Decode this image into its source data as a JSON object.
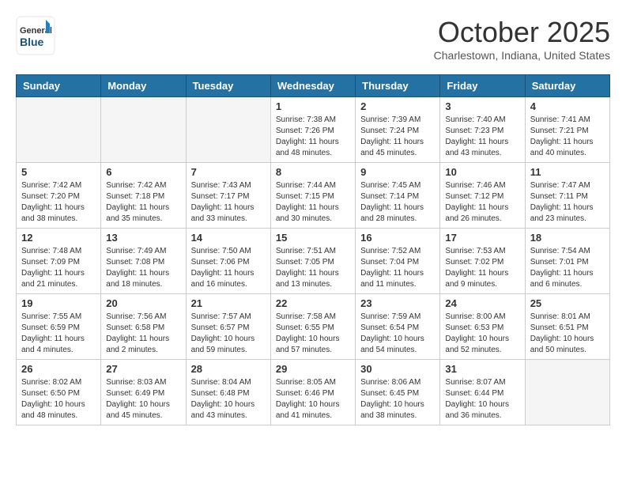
{
  "header": {
    "logo": {
      "general": "General",
      "blue": "Blue"
    },
    "title": "October 2025",
    "location": "Charlestown, Indiana, United States"
  },
  "calendar": {
    "days_of_week": [
      "Sunday",
      "Monday",
      "Tuesday",
      "Wednesday",
      "Thursday",
      "Friday",
      "Saturday"
    ],
    "weeks": [
      {
        "days": [
          {
            "number": "",
            "info": ""
          },
          {
            "number": "",
            "info": ""
          },
          {
            "number": "",
            "info": ""
          },
          {
            "number": "1",
            "info": "Sunrise: 7:38 AM\nSunset: 7:26 PM\nDaylight: 11 hours\nand 48 minutes."
          },
          {
            "number": "2",
            "info": "Sunrise: 7:39 AM\nSunset: 7:24 PM\nDaylight: 11 hours\nand 45 minutes."
          },
          {
            "number": "3",
            "info": "Sunrise: 7:40 AM\nSunset: 7:23 PM\nDaylight: 11 hours\nand 43 minutes."
          },
          {
            "number": "4",
            "info": "Sunrise: 7:41 AM\nSunset: 7:21 PM\nDaylight: 11 hours\nand 40 minutes."
          }
        ]
      },
      {
        "days": [
          {
            "number": "5",
            "info": "Sunrise: 7:42 AM\nSunset: 7:20 PM\nDaylight: 11 hours\nand 38 minutes."
          },
          {
            "number": "6",
            "info": "Sunrise: 7:42 AM\nSunset: 7:18 PM\nDaylight: 11 hours\nand 35 minutes."
          },
          {
            "number": "7",
            "info": "Sunrise: 7:43 AM\nSunset: 7:17 PM\nDaylight: 11 hours\nand 33 minutes."
          },
          {
            "number": "8",
            "info": "Sunrise: 7:44 AM\nSunset: 7:15 PM\nDaylight: 11 hours\nand 30 minutes."
          },
          {
            "number": "9",
            "info": "Sunrise: 7:45 AM\nSunset: 7:14 PM\nDaylight: 11 hours\nand 28 minutes."
          },
          {
            "number": "10",
            "info": "Sunrise: 7:46 AM\nSunset: 7:12 PM\nDaylight: 11 hours\nand 26 minutes."
          },
          {
            "number": "11",
            "info": "Sunrise: 7:47 AM\nSunset: 7:11 PM\nDaylight: 11 hours\nand 23 minutes."
          }
        ]
      },
      {
        "days": [
          {
            "number": "12",
            "info": "Sunrise: 7:48 AM\nSunset: 7:09 PM\nDaylight: 11 hours\nand 21 minutes."
          },
          {
            "number": "13",
            "info": "Sunrise: 7:49 AM\nSunset: 7:08 PM\nDaylight: 11 hours\nand 18 minutes."
          },
          {
            "number": "14",
            "info": "Sunrise: 7:50 AM\nSunset: 7:06 PM\nDaylight: 11 hours\nand 16 minutes."
          },
          {
            "number": "15",
            "info": "Sunrise: 7:51 AM\nSunset: 7:05 PM\nDaylight: 11 hours\nand 13 minutes."
          },
          {
            "number": "16",
            "info": "Sunrise: 7:52 AM\nSunset: 7:04 PM\nDaylight: 11 hours\nand 11 minutes."
          },
          {
            "number": "17",
            "info": "Sunrise: 7:53 AM\nSunset: 7:02 PM\nDaylight: 11 hours\nand 9 minutes."
          },
          {
            "number": "18",
            "info": "Sunrise: 7:54 AM\nSunset: 7:01 PM\nDaylight: 11 hours\nand 6 minutes."
          }
        ]
      },
      {
        "days": [
          {
            "number": "19",
            "info": "Sunrise: 7:55 AM\nSunset: 6:59 PM\nDaylight: 11 hours\nand 4 minutes."
          },
          {
            "number": "20",
            "info": "Sunrise: 7:56 AM\nSunset: 6:58 PM\nDaylight: 11 hours\nand 2 minutes."
          },
          {
            "number": "21",
            "info": "Sunrise: 7:57 AM\nSunset: 6:57 PM\nDaylight: 10 hours\nand 59 minutes."
          },
          {
            "number": "22",
            "info": "Sunrise: 7:58 AM\nSunset: 6:55 PM\nDaylight: 10 hours\nand 57 minutes."
          },
          {
            "number": "23",
            "info": "Sunrise: 7:59 AM\nSunset: 6:54 PM\nDaylight: 10 hours\nand 54 minutes."
          },
          {
            "number": "24",
            "info": "Sunrise: 8:00 AM\nSunset: 6:53 PM\nDaylight: 10 hours\nand 52 minutes."
          },
          {
            "number": "25",
            "info": "Sunrise: 8:01 AM\nSunset: 6:51 PM\nDaylight: 10 hours\nand 50 minutes."
          }
        ]
      },
      {
        "days": [
          {
            "number": "26",
            "info": "Sunrise: 8:02 AM\nSunset: 6:50 PM\nDaylight: 10 hours\nand 48 minutes."
          },
          {
            "number": "27",
            "info": "Sunrise: 8:03 AM\nSunset: 6:49 PM\nDaylight: 10 hours\nand 45 minutes."
          },
          {
            "number": "28",
            "info": "Sunrise: 8:04 AM\nSunset: 6:48 PM\nDaylight: 10 hours\nand 43 minutes."
          },
          {
            "number": "29",
            "info": "Sunrise: 8:05 AM\nSunset: 6:46 PM\nDaylight: 10 hours\nand 41 minutes."
          },
          {
            "number": "30",
            "info": "Sunrise: 8:06 AM\nSunset: 6:45 PM\nDaylight: 10 hours\nand 38 minutes."
          },
          {
            "number": "31",
            "info": "Sunrise: 8:07 AM\nSunset: 6:44 PM\nDaylight: 10 hours\nand 36 minutes."
          },
          {
            "number": "",
            "info": ""
          }
        ]
      }
    ]
  }
}
